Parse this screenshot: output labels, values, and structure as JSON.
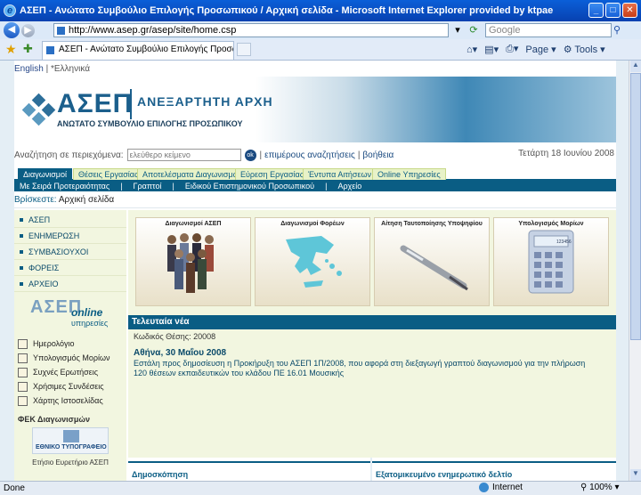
{
  "window": {
    "title": "ΑΣΕΠ - Ανώτατο Συμβούλιο Επιλογής Προσωπικού / Αρχική σελίδα - Microsoft Internet Explorer provided by ktpae"
  },
  "browser": {
    "url": "http://www.asep.gr/asep/site/home.csp",
    "search_placeholder": "Google",
    "tab_title": "ΑΣΕΠ - Ανώτατο Συμβούλιο Επιλογής Προσωπικού / Α...",
    "page_label": "Page",
    "tools_label": "Tools",
    "status_left": "Done",
    "status_zone": "Internet",
    "zoom": "100%"
  },
  "site": {
    "lang_en": "English",
    "lang_gr": "Ελληνικά",
    "logo_text": "ΑΣΕΠ",
    "logo_independent": "ΑΝΕΞΑΡΤΗΤΗ ΑΡΧΗ",
    "logo_sub": "ΑΝΩΤΑΤΟ ΣΥΜΒΟΥΛΙΟ ΕΠΙΛΟΓΗΣ ΠΡΟΣΩΠΙΚΟΥ",
    "search_label": "Αναζήτηση σε περιεχόμενα:",
    "search_placeholder": "ελεύθερο κείμενο",
    "ok": "ok",
    "advanced": "επιμέρους αναζητήσεις",
    "help": "βοήθεια",
    "date": "Τετάρτη 18 Ιουνίου 2008",
    "tabs": [
      "Διαγωνισμοί",
      "Θέσεις Εργασίας",
      "Αποτελέσματα Διαγωνισμών",
      "Εύρεση Εργασίας",
      "Έντυπα Αιτήσεων",
      "Online Υπηρεσίες"
    ],
    "subtabs": [
      "Με Σειρά Προτεραιότητας",
      "Γραπτοί",
      "Ειδικού Επιστημονικού Προσωπικού",
      "Αρχείο"
    ],
    "crumb_label": "Βρίσκεστε:",
    "crumb_page": "Αρχική σελίδα",
    "menu": [
      "ΑΣΕΠ",
      "ΕΝΗΜΕΡΩΣΗ",
      "ΣΥΜΒΑΣΙΟΥΧΟΙ",
      "ΦΟΡΕΙΣ",
      "ΑΡΧΕΙΟ"
    ],
    "online_a": "ΑΣΕΠ",
    "online_b": "online",
    "online_c": "υπηρεσίες",
    "tools": [
      "Ημερολόγιο",
      "Υπολογισμός Μορίων",
      "Συχνές Ερωτήσεις",
      "Χρήσιμες Συνδέσεις",
      "Χάρτης Ιστοσελίδας"
    ],
    "fek_title": "ΦΕΚ Διαγωνισμών",
    "typo_text": "ΕΘΝΙΚΟ ΤΥΠΟΓΡΑΦΕΙΟ",
    "eyr": "Ετήσιο Ευρετήριο ΑΣΕΠ",
    "cards": [
      "Διαγωνισμοί ΑΣΕΠ",
      "Διαγωνισμοί Φορέων",
      "Αίτηση Ταυτοποίησης Υποψηφίου",
      "Υπολογισμός Μορίων"
    ],
    "calc_display": "123456",
    "news_title": "Τελευταία νέα",
    "news_code": "Κωδικός Θέσης: 20008",
    "news_date": "Αθήνα, 30 Μαΐου 2008",
    "news_text": "Εστάλη προς δημοσίευση η Προκήρυξη του ΑΣΕΠ 1Π/2008, που αφορά στη διεξαγωγή γραπτού διαγωνισμού για την πλήρωση 120 θέσεων εκπαιδευτικών του κλάδου ΠΕ 16.01 Μουσικής",
    "poll": "Δημοσκόπηση",
    "newsletter": "Εξατομικευμένο ενημερωτικό δελτίο"
  }
}
